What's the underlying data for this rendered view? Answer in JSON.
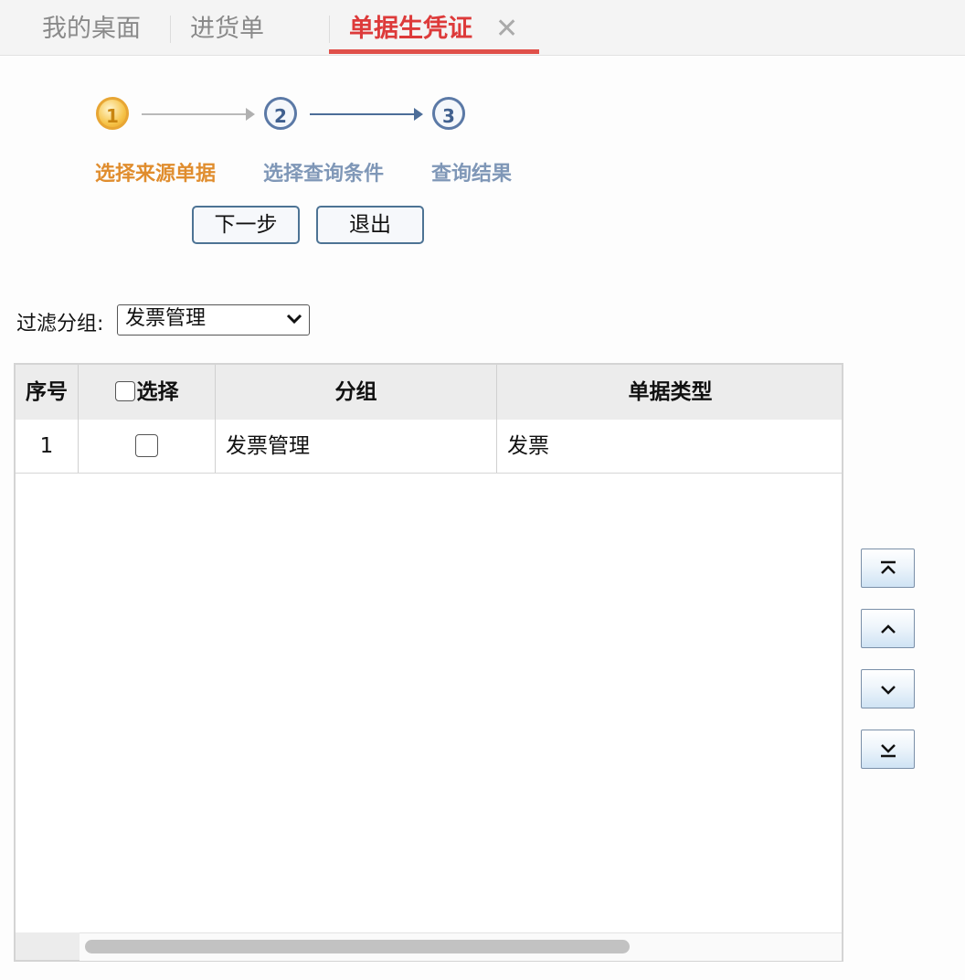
{
  "tabs": [
    {
      "label": "我的桌面",
      "active": false
    },
    {
      "label": "进货单",
      "active": false
    },
    {
      "label": "单据生凭证",
      "active": true,
      "closable": true
    }
  ],
  "tab_close_symbol": "✕",
  "stepper": {
    "steps": [
      {
        "number": "1",
        "label": "选择来源单据",
        "state": "current"
      },
      {
        "number": "2",
        "label": "选择查询条件",
        "state": "pending"
      },
      {
        "number": "3",
        "label": "查询结果",
        "state": "pending"
      }
    ]
  },
  "buttons": {
    "next_label": "下一步",
    "exit_label": "退出"
  },
  "filter": {
    "label": "过滤分组:",
    "selected": "发票管理"
  },
  "grid": {
    "columns": [
      "序号",
      "选择",
      "分组",
      "单据类型"
    ],
    "rows": [
      {
        "index": "1",
        "checked": false,
        "group": "发票管理",
        "doc_type": "发票"
      }
    ]
  },
  "sort_buttons": [
    "move-to-top-icon",
    "move-up-icon",
    "move-down-icon",
    "move-to-bottom-icon"
  ],
  "colors": {
    "active_tab": "#dd3a3a",
    "current_step": "#e08d2e",
    "pending_step": "#7f97b7",
    "button_border": "#4d7394"
  }
}
